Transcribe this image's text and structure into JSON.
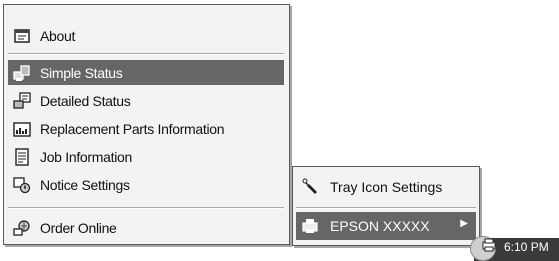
{
  "menu": {
    "items": [
      {
        "label": "About",
        "icon": "about-window-icon"
      },
      {
        "label": "Simple Status",
        "icon": "status-icon",
        "selected": true
      },
      {
        "label": "Detailed Status",
        "icon": "detailed-status-icon"
      },
      {
        "label": "Replacement Parts Information",
        "icon": "ink-cartridge-icon"
      },
      {
        "label": "Job Information",
        "icon": "document-icon"
      },
      {
        "label": "Notice Settings",
        "icon": "notice-icon"
      },
      {
        "label": "Order Online",
        "icon": "order-online-icon"
      }
    ]
  },
  "submenu": {
    "items": [
      {
        "label": "Tray Icon Settings",
        "icon": "wrench-icon"
      },
      {
        "label": "EPSON XXXXX",
        "icon": "printer-icon",
        "selected": true,
        "has_submenu": true
      }
    ]
  },
  "taskbar": {
    "clock": "6:10 PM"
  },
  "colors": {
    "highlight": "#666666",
    "menu_background": "#f3f3f3",
    "taskbar": "#3a3a3a"
  }
}
